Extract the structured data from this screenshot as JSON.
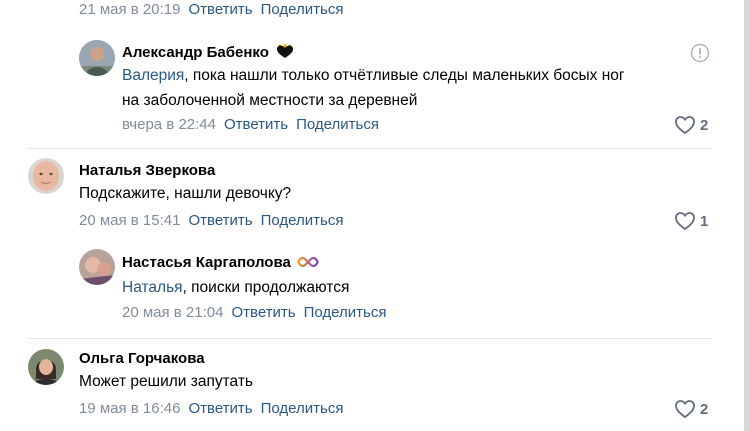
{
  "top": {
    "date": "21 мая в 20:19",
    "reply_label": "Ответить",
    "share_label": "Поделиться"
  },
  "comments": [
    {
      "author": "Александр Бабенко",
      "reply_to": "Валерия",
      "text_line1": ", пока нашли только отчётливые следы маленьких босых ног",
      "text_line2": "на заболоченной местности за деревней",
      "date": "вчера в 22:44",
      "reply_label": "Ответить",
      "share_label": "Поделиться",
      "likes": "2"
    },
    {
      "author": "Наталья Зверкова",
      "text": "Подскажите, нашли девочку?",
      "date": "20 мая в 15:41",
      "reply_label": "Ответить",
      "share_label": "Поделиться",
      "likes": "1"
    },
    {
      "author": "Настасья Каргаполова",
      "reply_to": "Наталья",
      "text": ", поиски продолжаются",
      "date": "20 мая в 21:04",
      "reply_label": "Ответить",
      "share_label": "Поделиться"
    },
    {
      "author": "Ольга Горчакова",
      "text": "Может решили запутать",
      "date": "19 мая в 16:46",
      "reply_label": "Ответить",
      "share_label": "Поделиться",
      "likes": "2"
    }
  ],
  "colors": {
    "link": "#2a5885",
    "meta": "#818c99",
    "like_icon": "#626d7a",
    "divider": "#e7e8ec"
  }
}
